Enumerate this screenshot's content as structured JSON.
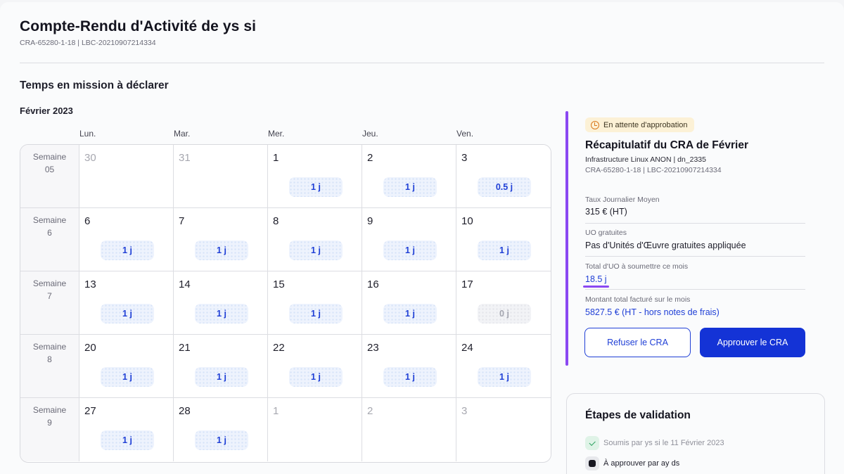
{
  "header": {
    "title": "Compte-Rendu d'Activité de ys si",
    "subtitle": "CRA-65280-1-18 | LBC-20210907214334"
  },
  "calendar": {
    "section_title": "Temps en mission à déclarer",
    "month": "Février 2023",
    "day_headers": [
      "Lun.",
      "Mar.",
      "Mer.",
      "Jeu.",
      "Ven."
    ],
    "weeks": [
      {
        "label": "Semaine 05",
        "days": [
          {
            "num": "30",
            "out": true,
            "value": ""
          },
          {
            "num": "31",
            "out": true,
            "value": ""
          },
          {
            "num": "1",
            "out": false,
            "value": "1 j"
          },
          {
            "num": "2",
            "out": false,
            "value": "1 j"
          },
          {
            "num": "3",
            "out": false,
            "value": "0.5 j"
          }
        ]
      },
      {
        "label": "Semaine 6",
        "days": [
          {
            "num": "6",
            "out": false,
            "value": "1 j"
          },
          {
            "num": "7",
            "out": false,
            "value": "1 j"
          },
          {
            "num": "8",
            "out": false,
            "value": "1 j"
          },
          {
            "num": "9",
            "out": false,
            "value": "1 j"
          },
          {
            "num": "10",
            "out": false,
            "value": "1 j"
          }
        ]
      },
      {
        "label": "Semaine 7",
        "days": [
          {
            "num": "13",
            "out": false,
            "value": "1 j"
          },
          {
            "num": "14",
            "out": false,
            "value": "1 j"
          },
          {
            "num": "15",
            "out": false,
            "value": "1 j"
          },
          {
            "num": "16",
            "out": false,
            "value": "1 j"
          },
          {
            "num": "17",
            "out": false,
            "value": "0 j",
            "zero": true
          }
        ]
      },
      {
        "label": "Semaine 8",
        "days": [
          {
            "num": "20",
            "out": false,
            "value": "1 j"
          },
          {
            "num": "21",
            "out": false,
            "value": "1 j"
          },
          {
            "num": "22",
            "out": false,
            "value": "1 j"
          },
          {
            "num": "23",
            "out": false,
            "value": "1 j"
          },
          {
            "num": "24",
            "out": false,
            "value": "1 j"
          }
        ]
      },
      {
        "label": "Semaine 9",
        "days": [
          {
            "num": "27",
            "out": false,
            "value": "1 j"
          },
          {
            "num": "28",
            "out": false,
            "value": "1 j"
          },
          {
            "num": "1",
            "out": true,
            "value": ""
          },
          {
            "num": "2",
            "out": true,
            "value": ""
          },
          {
            "num": "3",
            "out": true,
            "value": ""
          }
        ]
      }
    ]
  },
  "summary": {
    "status_badge": "En attente d'approbation",
    "title": "Récapitulatif du CRA de Février",
    "line1": "Infrastructure Linux ANON | dn_2335",
    "line2": "CRA-65280-1-18 | LBC-20210907214334",
    "tjm_label": "Taux Journalier Moyen",
    "tjm_value": "315 € (HT)",
    "uo_free_label": "UO gratuites",
    "uo_free_value": "Pas d'Unités d'Œuvre gratuites appliquée",
    "uo_total_label": "Total d'UO à soumettre ce mois",
    "uo_total_value": "18.5 j",
    "amount_label": "Montant total facturé sur le mois",
    "amount_value": "5827.5 € (HT - hors notes de frais)",
    "refuse_label": "Refuser le CRA",
    "approve_label": "Approuver le CRA"
  },
  "steps": {
    "title": "Étapes de validation",
    "items": [
      {
        "label": "Soumis par ys si le 11 Février 2023",
        "done": true
      },
      {
        "label": "À approuver par ay ds",
        "done": false
      }
    ]
  },
  "colors": {
    "accent": "#1433d6",
    "purple": "#8b48f2",
    "badge_bg": "#fcf1d6",
    "done_green": "#2aa05f"
  }
}
